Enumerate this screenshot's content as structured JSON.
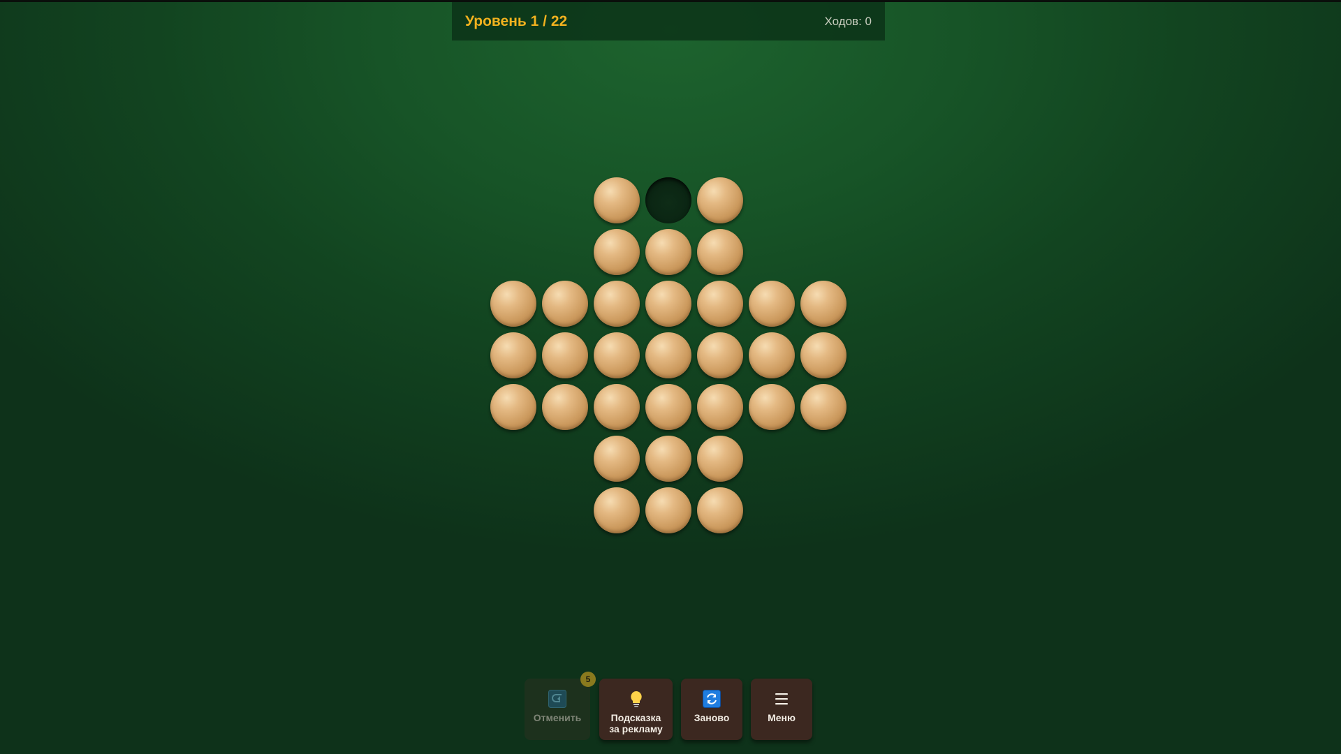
{
  "header": {
    "level_label": "Уровень 1 / 22",
    "moves_label": "Ходов: 0"
  },
  "board": {
    "layout": [
      "..PHP..",
      "..PPP..",
      "PPPPPPP",
      "PPPPPPP",
      "PPPPPPP",
      "..PPP..",
      "..PPP.."
    ],
    "legend": {
      "P": "peg",
      "H": "empty-hole",
      ".": "no-cell"
    },
    "peg_count": 32
  },
  "toolbar": {
    "undo": {
      "label": "Отменить",
      "badge": "5",
      "icon": "undo-icon",
      "enabled": false
    },
    "hint": {
      "label_line1": "Подсказка",
      "label_line2": "за рекламу",
      "icon": "lightbulb-icon"
    },
    "restart": {
      "label": "Заново",
      "icon": "restart-icon"
    },
    "menu": {
      "label": "Меню",
      "icon": "hamburger-menu-icon"
    }
  },
  "colors": {
    "background": "#175427",
    "accent": "#f2b21f",
    "peg": "#d9a86c",
    "button": "#3c2820"
  }
}
